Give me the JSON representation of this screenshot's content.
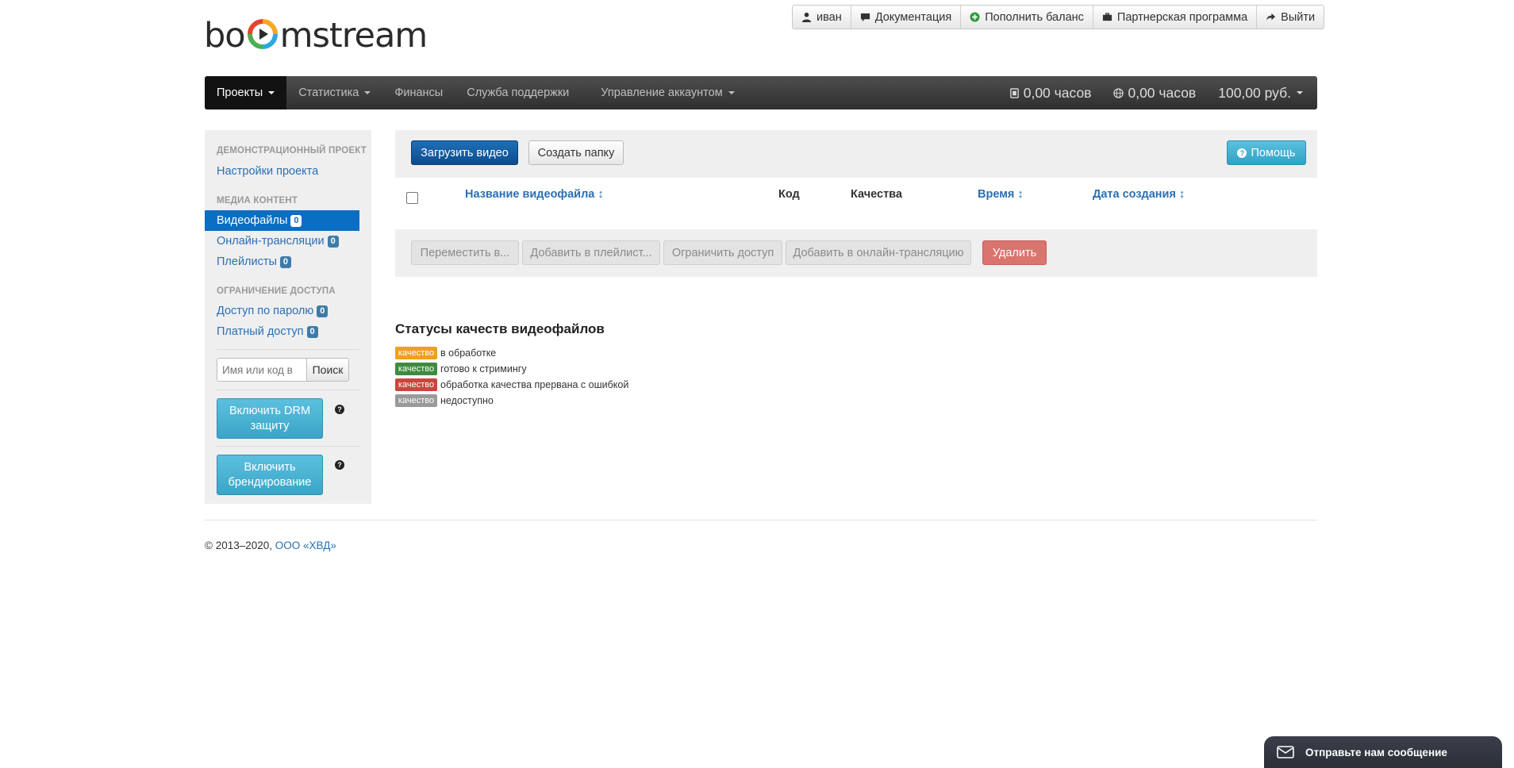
{
  "brand": {
    "logo_text_left": "bo",
    "logo_text_right": "mstream",
    "logo_colors": [
      "#e8432e",
      "#f5a623",
      "#2aa9e0",
      "#4caf50"
    ]
  },
  "topbar": {
    "user": "иван",
    "docs": "Документация",
    "topup": "Пополнить баланс",
    "partner": "Партнерская программа",
    "logout": "Выйти"
  },
  "nav": {
    "projects": "Проекты",
    "stats": "Статистика",
    "finance": "Финансы",
    "support": "Служба поддержки",
    "account": "Управление аккаунтом",
    "hours_storage": "0,00 часов",
    "hours_traffic": "0,00 часов",
    "balance": "100,00 руб."
  },
  "sidebar": {
    "demo_header": "Демонстрационный проект",
    "project_settings": "Настройки проекта",
    "media_header": "Медиа контент",
    "videos": "Видеофайлы",
    "videos_count": "0",
    "live": "Онлайн-трансляции",
    "live_count": "0",
    "playlists": "Плейлисты",
    "playlists_count": "0",
    "access_header": "Ограничение доступа",
    "password_access": "Доступ по паролю",
    "password_count": "0",
    "paid_access": "Платный доступ",
    "paid_count": "0",
    "search_placeholder": "Имя или код в",
    "search_button": "Поиск",
    "drm_line1": "Включить DRM",
    "drm_line2": "защиту",
    "brand_line1": "Включить",
    "brand_line2": "брендирование",
    "help_mark": "?"
  },
  "toolbar": {
    "upload": "Загрузить видео",
    "new_folder": "Создать папку",
    "help": "Помощь"
  },
  "table": {
    "col_name": "Название видеофайла",
    "col_code": "Код",
    "col_quality": "Качества",
    "col_time": "Время",
    "col_created": "Дата создания",
    "sort_glyph": "↕"
  },
  "actions": {
    "move": "Переместить в...",
    "add_playlist": "Добавить в плейлист...",
    "restrict": "Ограничить доступ",
    "add_live": "Добавить в онлайн-трансляцию",
    "delete": "Удалить"
  },
  "statuses": {
    "title": "Статусы качеств видеофайлов",
    "label": "качество",
    "items": [
      {
        "text": "в обработке",
        "color": "#f0a020"
      },
      {
        "text": "готово к стримингу",
        "color": "#3f8a3f"
      },
      {
        "text": "обработка качества прервана с ошибкой",
        "color": "#c9463d"
      },
      {
        "text": "недоступно",
        "color": "#9a9a9a"
      }
    ]
  },
  "footer": {
    "copyright": "© 2013–2020, ",
    "company": "ООО «ХВД»"
  },
  "chat": {
    "label": "Отправьте нам сообщение"
  }
}
